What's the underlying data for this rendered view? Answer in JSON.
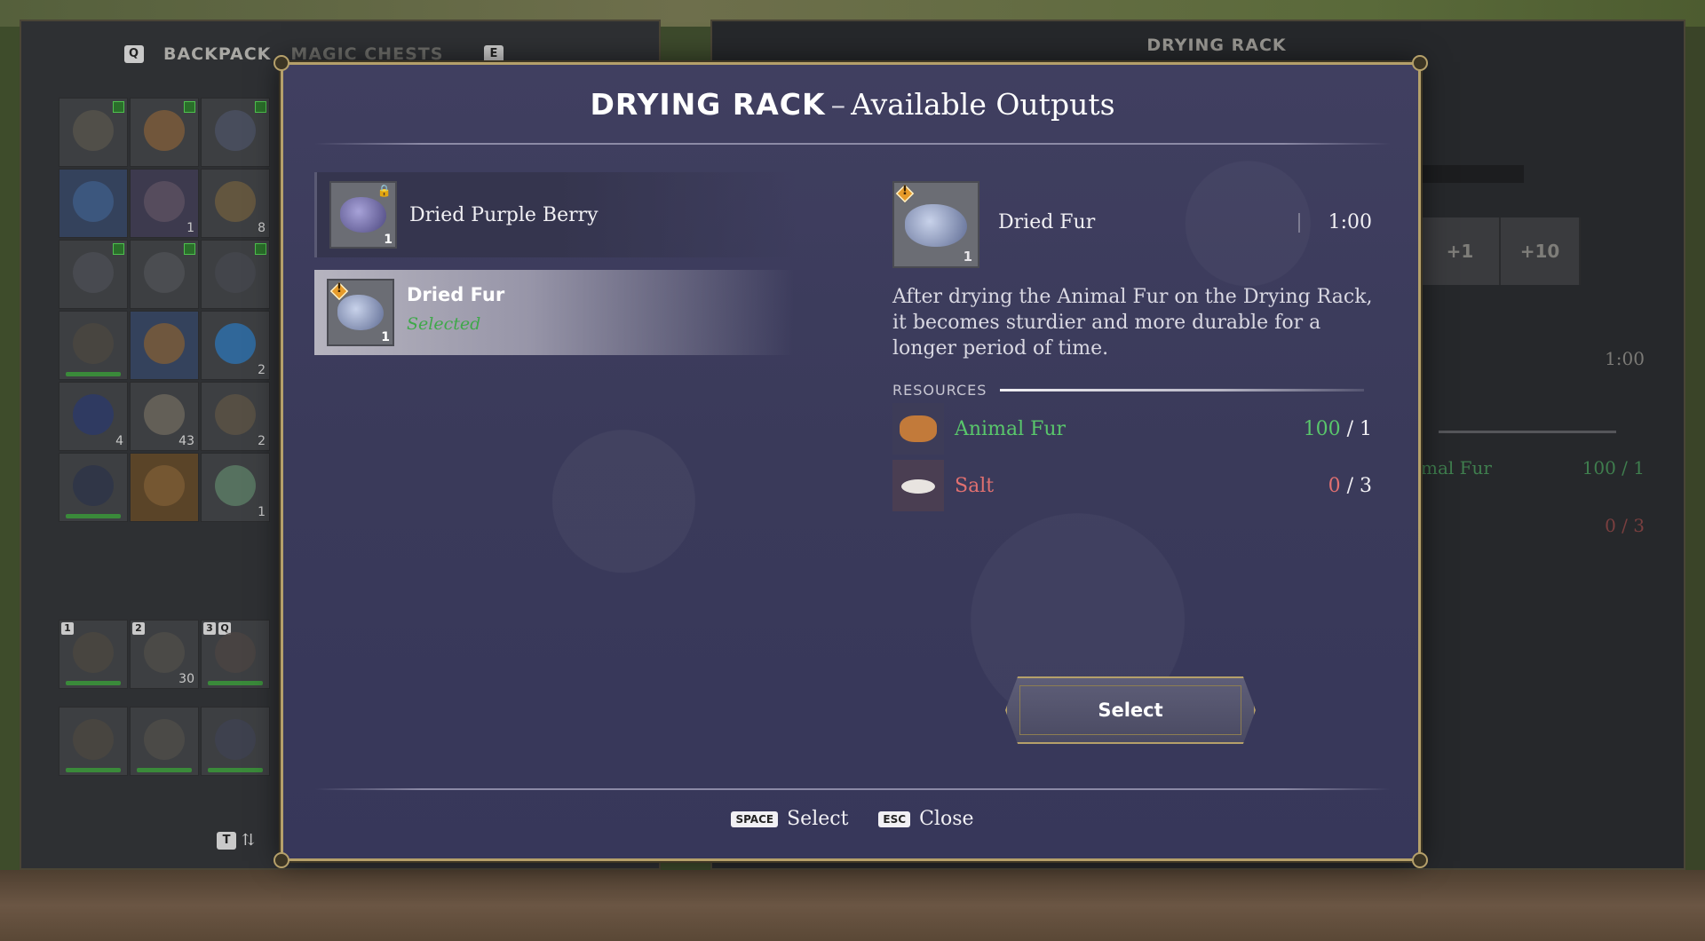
{
  "inventory": {
    "tab_key_left": "Q",
    "tab_backpack": "BACKPACK",
    "tab_magic_chests": "MAGIC CHESTS",
    "tab_key_right": "E",
    "slot_counts": [
      "",
      "",
      "",
      "",
      "1",
      "8",
      "",
      "",
      "",
      "",
      "",
      "2",
      "4",
      "43",
      "2",
      "",
      "",
      "1"
    ],
    "hotbar_numbers": [
      "1",
      "2",
      "3"
    ],
    "hotbar_counts": [
      "",
      "30",
      ""
    ],
    "hotbar_3_extra_key": "Q",
    "sort_key": "T"
  },
  "rack_panel": {
    "title": "DRYING RACK",
    "steps": [
      "+1",
      "+10"
    ],
    "time": "1:00",
    "res1_name": "mal Fur",
    "res1_qty": "100 / 1",
    "res2_qty": "0 / 3"
  },
  "modal": {
    "title_bold": "DRYING RACK",
    "title_dash": "–",
    "title_rest": "Available Outputs",
    "outputs": [
      {
        "name": "Dried Purple Berry",
        "quantity": "1",
        "icon": "purple-berry-icon"
      },
      {
        "name": "Dried Fur",
        "status": "Selected",
        "quantity": "1",
        "icon": "fur-icon"
      }
    ],
    "detail": {
      "name": "Dried Fur",
      "quantity": "1",
      "time": "1:00",
      "description": "After drying the Animal Fur on the Drying Rack, it becomes sturdier and more durable for a longer period of time.",
      "resources_label": "RESOURCES",
      "resources": [
        {
          "name": "Animal Fur",
          "have": "100",
          "need": "1",
          "icon": "animal-fur-icon"
        },
        {
          "name": "Salt",
          "have": "0",
          "need": "3",
          "icon": "salt-icon"
        }
      ]
    },
    "select_label": "Select",
    "hints": [
      {
        "key": "SPACE",
        "label": "Select"
      },
      {
        "key": "ESC",
        "label": "Close"
      }
    ]
  },
  "colors": {
    "modal_bg": "#3c3c5c",
    "gold_border": "#b5a06a",
    "have_enough": "#59c76b",
    "missing": "#e07070",
    "selected_status": "#3fa84a"
  }
}
